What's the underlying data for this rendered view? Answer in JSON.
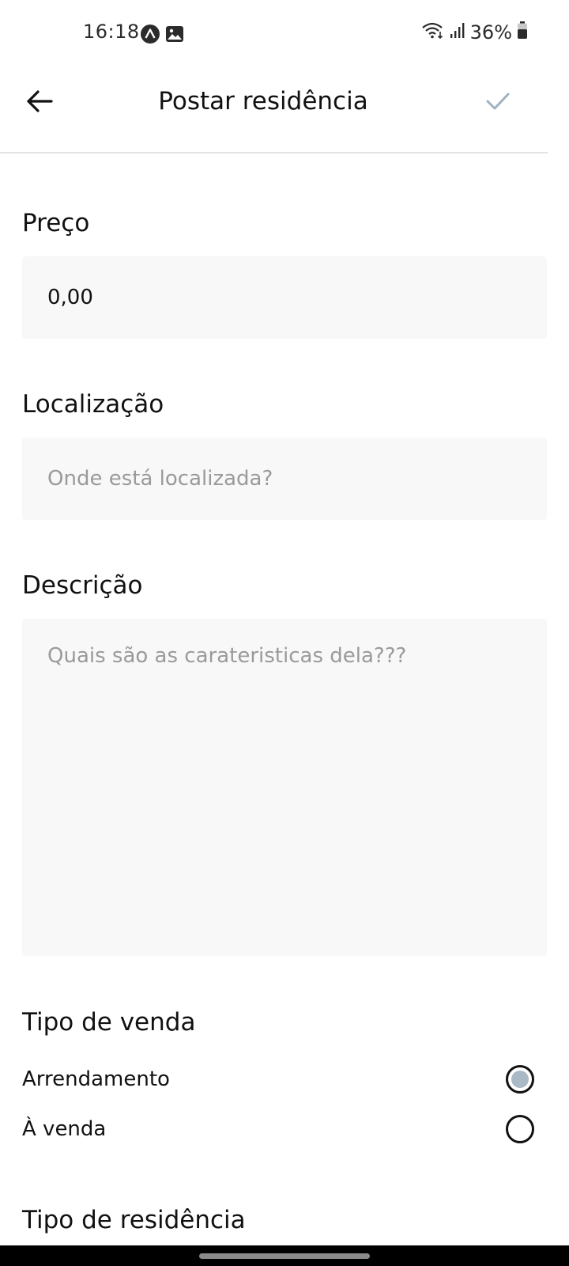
{
  "status_bar": {
    "time": "16:18",
    "battery": "36%",
    "icons": [
      "app-a-icon",
      "image-icon",
      "wifi-icon",
      "signal-icon",
      "battery-icon"
    ]
  },
  "app_bar": {
    "title": "Postar residência",
    "back_icon": "arrow-left-icon",
    "confirm_icon": "check-icon",
    "confirm_color": "#9fb3c2"
  },
  "form": {
    "price": {
      "label": "Preço",
      "value": "0,00"
    },
    "location": {
      "label": "Localização",
      "placeholder": "Onde está localizada?"
    },
    "description": {
      "label": "Descrição",
      "placeholder": "Quais são as carateristicas dela???"
    },
    "sale_type": {
      "label": "Tipo de venda",
      "options": [
        {
          "label": "Arrendamento",
          "selected": true
        },
        {
          "label": "À venda",
          "selected": false
        }
      ]
    },
    "residence_type": {
      "label": "Tipo de residência"
    }
  },
  "colors": {
    "field_bg": "#f8f8f8",
    "placeholder": "#9a9a9a",
    "radio_selected": "#a9b9c6"
  }
}
